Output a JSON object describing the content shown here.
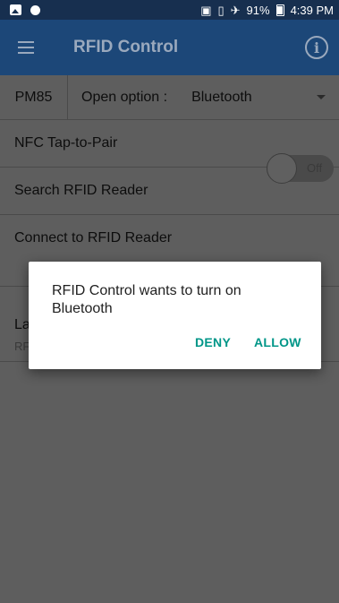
{
  "statusbar": {
    "battery_pct": "91%",
    "time": "4:39 PM",
    "icons": [
      "image-icon",
      "circle-icon",
      "nfc-icon",
      "vibrate-icon",
      "airplane-icon",
      "battery-icon"
    ]
  },
  "appbar": {
    "title": "RFID Control",
    "menu_icon": "hamburger-menu-icon",
    "info_icon": "info-icon",
    "info_glyph": "i",
    "color": "#1c4778"
  },
  "option_row": {
    "model": "PM85",
    "open_label": "Open option :",
    "selected_value": "Bluetooth"
  },
  "rows": {
    "nfc": "NFC Tap-to-Pair",
    "search": "Search RFID Reader",
    "connect": "Connect to RFID Reader",
    "toggle_state": "Off",
    "last_label": "La",
    "last_sub": "RF"
  },
  "dialog": {
    "message": "RFID Control wants to turn on Bluetooth",
    "deny": "DENY",
    "allow": "ALLOW",
    "accent_color": "#009688"
  }
}
